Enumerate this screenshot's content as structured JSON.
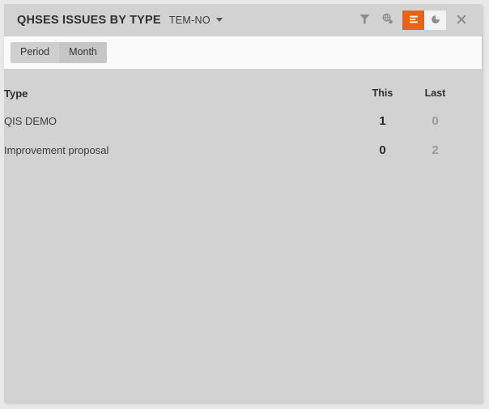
{
  "widget": {
    "title": "QHSES ISSUES BY TYPE",
    "entity": "TEM-NO",
    "accent_color": "#e8631a",
    "panel_color": "#d2d2d2",
    "tabstrip_color": "#fafafa"
  },
  "toolbar": {
    "filter_icon": "filter-funnel-icon",
    "globe_icon": "globe-icon",
    "bars_view_label": "bars-view",
    "pie_view_label": "pie-view",
    "close_label": "close"
  },
  "tabs": [
    {
      "label": "Period",
      "selected": false
    },
    {
      "label": "Month",
      "selected": true
    }
  ],
  "table": {
    "headers": {
      "type": "Type",
      "this": "This",
      "last": "Last"
    },
    "rows": [
      {
        "type": "QIS DEMO",
        "this": "1",
        "last": "0"
      },
      {
        "type": "Improvement proposal",
        "this": "0",
        "last": "2"
      }
    ]
  }
}
